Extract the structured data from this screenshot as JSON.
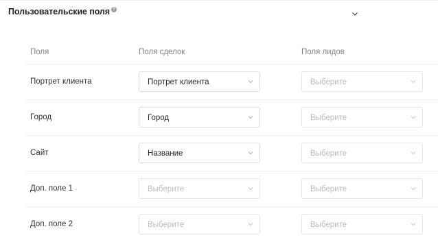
{
  "section": {
    "title": "Пользовательские поля",
    "info_icon": "info-icon",
    "toggle_icon": "chevron-down-icon"
  },
  "columns": {
    "field": "Поля",
    "deal": "Поля сделок",
    "lead": "Поля лидов"
  },
  "rows": [
    {
      "label": "Портрет клиента",
      "deal": "Портрет клиента",
      "deal_placeholder": false,
      "lead": "Выберите"
    },
    {
      "label": "Город",
      "deal": "Город",
      "deal_placeholder": false,
      "lead": "Выберите"
    },
    {
      "label": "Сайт",
      "deal": "Название",
      "deal_placeholder": false,
      "lead": "Выберите"
    },
    {
      "label": "Доп. поле 1",
      "deal": "Выберите",
      "deal_placeholder": true,
      "lead": "Выберите"
    },
    {
      "label": "Доп. поле 2",
      "deal": "Выберите",
      "deal_placeholder": true,
      "lead": "Выберите"
    }
  ]
}
